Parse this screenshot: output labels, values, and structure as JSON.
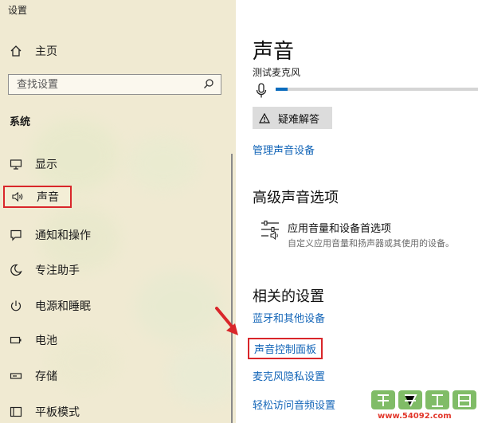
{
  "window": {
    "title": "设置"
  },
  "sidebar": {
    "home_label": "主页",
    "search": {
      "placeholder": "查找设置"
    },
    "section_label": "系统",
    "items": [
      {
        "label": "显示",
        "icon": "display-icon"
      },
      {
        "label": "声音",
        "icon": "speaker-icon",
        "active": true
      },
      {
        "label": "通知和操作",
        "icon": "notification-icon"
      },
      {
        "label": "专注助手",
        "icon": "moon-icon"
      },
      {
        "label": "电源和睡眠",
        "icon": "power-icon"
      },
      {
        "label": "电池",
        "icon": "battery-icon"
      },
      {
        "label": "存储",
        "icon": "storage-icon"
      },
      {
        "label": "平板模式",
        "icon": "tablet-icon"
      }
    ]
  },
  "main": {
    "title": "声音",
    "mic_test_label": "测试麦克风",
    "mic_level": 0.06,
    "troubleshoot_label": "疑难解答",
    "manage_devices_link": "管理声音设备",
    "advanced_heading": "高级声音选项",
    "app_volume": {
      "title": "应用音量和设备首选项",
      "description": "自定义应用音量和扬声器或其使用的设备。"
    },
    "related_heading": "相关的设置",
    "related_links": [
      {
        "label": "蓝牙和其他设备"
      },
      {
        "label": "声音控制面板",
        "highlighted": true
      },
      {
        "label": "麦克风隐私设置"
      },
      {
        "label": "轻松访问音频设置"
      }
    ]
  },
  "watermark": {
    "url": "www.54092.com"
  },
  "colors": {
    "accent": "#1466b8",
    "highlight_border": "#d9262a",
    "sidebar_bg": "#f0ead2"
  }
}
